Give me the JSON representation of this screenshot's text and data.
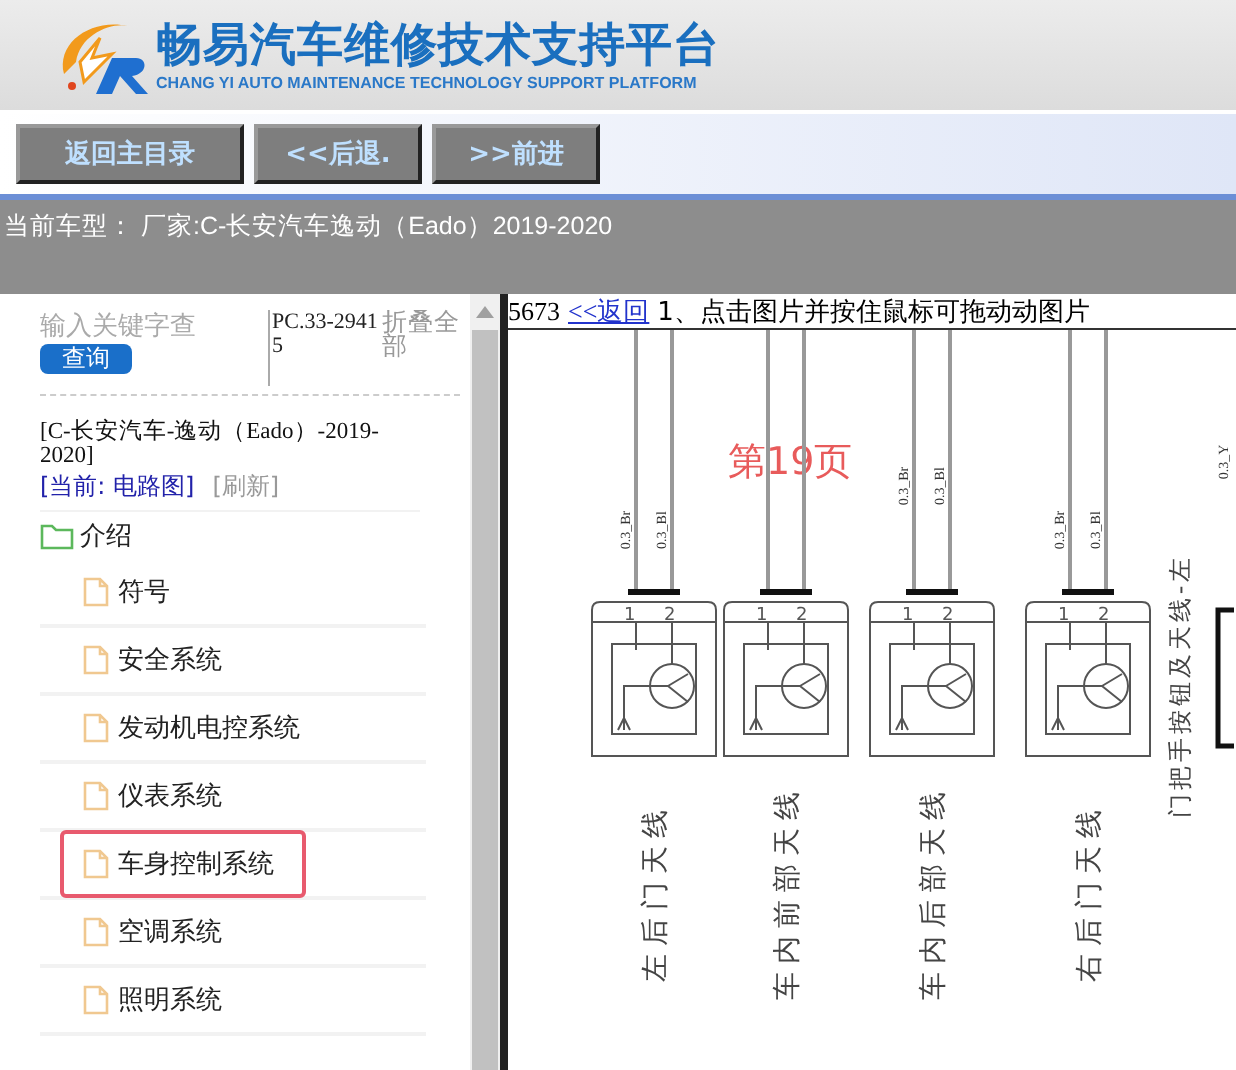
{
  "header": {
    "title": "畅易汽车维修技术支持平台",
    "subtitle": "CHANG YI AUTO MAINTENANCE TECHNOLOGY SUPPORT PLATFORM"
  },
  "toolbar": {
    "buttons": [
      "返回主目录",
      "<<后退.",
      ">>前进"
    ]
  },
  "vehicle_bar": {
    "text": "当前车型： 厂家:C-长安汽车逸动（Eado）2019-2020"
  },
  "sidebar": {
    "search": {
      "placeholder": "输入关键字查",
      "button": "查询"
    },
    "code": "PC.33-29415",
    "collapse_all": "折叠全部",
    "vehicle": "[C-长安汽车-逸动（Eado）-2019-2020]",
    "current": "[当前: 电路图]",
    "refresh": "[刷新]",
    "tree": [
      {
        "label": "介绍",
        "expanded": true,
        "children": [
          {
            "label": "符号",
            "selected": false
          },
          {
            "label": "安全系统",
            "selected": false
          },
          {
            "label": "发动机电控系统",
            "selected": false
          },
          {
            "label": "仪表系统",
            "selected": false
          },
          {
            "label": "车身控制系统",
            "selected": true
          },
          {
            "label": "空调系统",
            "selected": false
          },
          {
            "label": "照明系统",
            "selected": false
          }
        ]
      }
    ]
  },
  "viewer": {
    "count": "5673",
    "back_link": "<<返回",
    "hint": "1、点击图片并按住鼠标可拖动动图片",
    "diagram": {
      "page_label": "第19页",
      "side_label": "门把手按钮及天线-左",
      "partial_wire": "0.3_Y",
      "connectors": [
        {
          "label": "左后门天线",
          "pins": [
            "1",
            "2"
          ],
          "wires": [
            "0.3_Br",
            "0.3_Bl"
          ]
        },
        {
          "label": "车内前部天线",
          "pins": [
            "1",
            "2"
          ]
        },
        {
          "label": "车内后部天线",
          "pins": [
            "1",
            "2"
          ],
          "wires": [
            "0.3_Br",
            "0.3_Bl"
          ]
        },
        {
          "label": "右后门天线",
          "pins": [
            "1",
            "2"
          ],
          "wires": [
            "0.3_Br",
            "0.3_Bl"
          ]
        }
      ]
    }
  }
}
